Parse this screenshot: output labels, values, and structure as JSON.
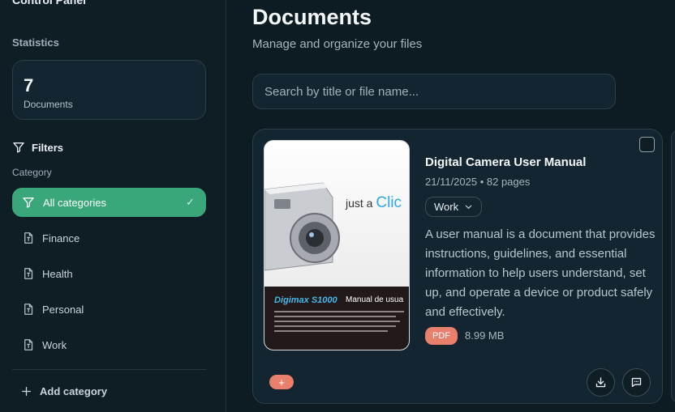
{
  "sidebar": {
    "app_title": "Control Panel",
    "statistics_label": "Statistics",
    "stat": {
      "value": "7",
      "label": "Documents"
    },
    "filters_label": "Filters",
    "category_label": "Category",
    "categories": [
      {
        "label": "All categories",
        "icon": "funnel-icon",
        "active": true
      },
      {
        "label": "Finance",
        "icon": "file-icon"
      },
      {
        "label": "Health",
        "icon": "file-icon"
      },
      {
        "label": "Personal",
        "icon": "file-icon"
      },
      {
        "label": "Work",
        "icon": "file-icon"
      }
    ],
    "add_category_label": "Add category"
  },
  "main": {
    "title": "Documents",
    "subtitle": "Manage and organize your files",
    "search": {
      "placeholder": "Search by title or file name...",
      "value": ""
    },
    "documents": [
      {
        "title": "Digital Camera User Manual",
        "date": "21/11/2025",
        "pages": "82 pages",
        "meta": "21/11/2025 • 82 pages",
        "tag": "Work",
        "description": "A user manual is a document that provides instructions, guidelines, and essential information to help users understand, set up, and operate a device or product safely and effectively.",
        "file_type": "PDF",
        "file_size": "8.99 MB",
        "thumbnail": {
          "slogan_prefix": "just a ",
          "slogan_highlight": "Clic",
          "brand": "Digimax S1000",
          "brand_sub": "Manual de usua"
        },
        "add_button": "+"
      }
    ]
  },
  "colors": {
    "background": "#0d1b22",
    "card": "#132530",
    "accent_green": "#3aa77b",
    "accent_coral": "#e9806d"
  }
}
